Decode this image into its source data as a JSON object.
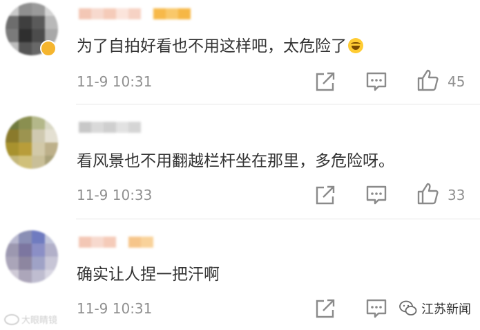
{
  "comments": [
    {
      "username": "",
      "text": "为了自拍好看也不用这样吧，太危险了",
      "emoji": "laughing-crying-emoji",
      "time": "11-9 10:31",
      "likes": "45"
    },
    {
      "username": "",
      "text": "看风景也不用翻越栏杆坐在那里，多危险呀。",
      "time": "11-9 10:33",
      "likes": "33"
    },
    {
      "username": "",
      "text": "确实让人捏一把汗啊",
      "time": "11-9 10:31",
      "likes": ""
    }
  ],
  "icons": {
    "share": "share-icon",
    "reply": "comment-icon",
    "like": "thumbs-up-icon"
  },
  "colors": {
    "text": "#333333",
    "meta": "#909090",
    "divider": "#e6e6e6",
    "badge": "#f5b52e"
  },
  "watermarks": {
    "left": "大眼睛镜",
    "right": "江苏新闻"
  }
}
